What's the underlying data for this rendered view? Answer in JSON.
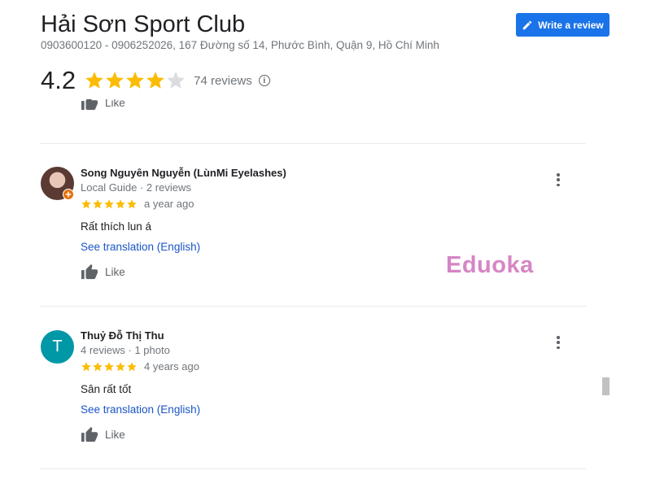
{
  "place": {
    "title": "Hải Sơn Sport Club",
    "address": "0903600120 - 0906252026, 167 Đường số 14, Phước Bình, Quận 9, Hồ Chí Minh",
    "rating": "4.2",
    "rating_stars": 4,
    "review_count": "74 reviews",
    "info_icon": "i"
  },
  "toolbar": {
    "write_review_label": "Write a review",
    "write_review_icon": "pencil-icon"
  },
  "like_label": "Like",
  "reviews": [
    {
      "author": "Song Nguyên Nguyễn (LùnMi Eyelashes)",
      "meta": "Local Guide · 2 reviews",
      "stars": 5,
      "time": "a year ago",
      "text": "Rất thích lun á",
      "translate": "See translation (English)",
      "avatar_type": "photo"
    },
    {
      "author": "Thuỷ Đỗ Thị Thu",
      "meta": "4 reviews · 1 photo",
      "stars": 5,
      "time": "4 years ago",
      "text": "Sân rất tốt",
      "translate": "See translation (English)",
      "avatar_letter": "T",
      "avatar_color": "#0097a7"
    }
  ],
  "watermark": "Eduoka",
  "colors": {
    "accent": "#1a73e8",
    "star": "#fbbc04",
    "star_empty": "#dadce0",
    "link": "#1a55c7"
  }
}
